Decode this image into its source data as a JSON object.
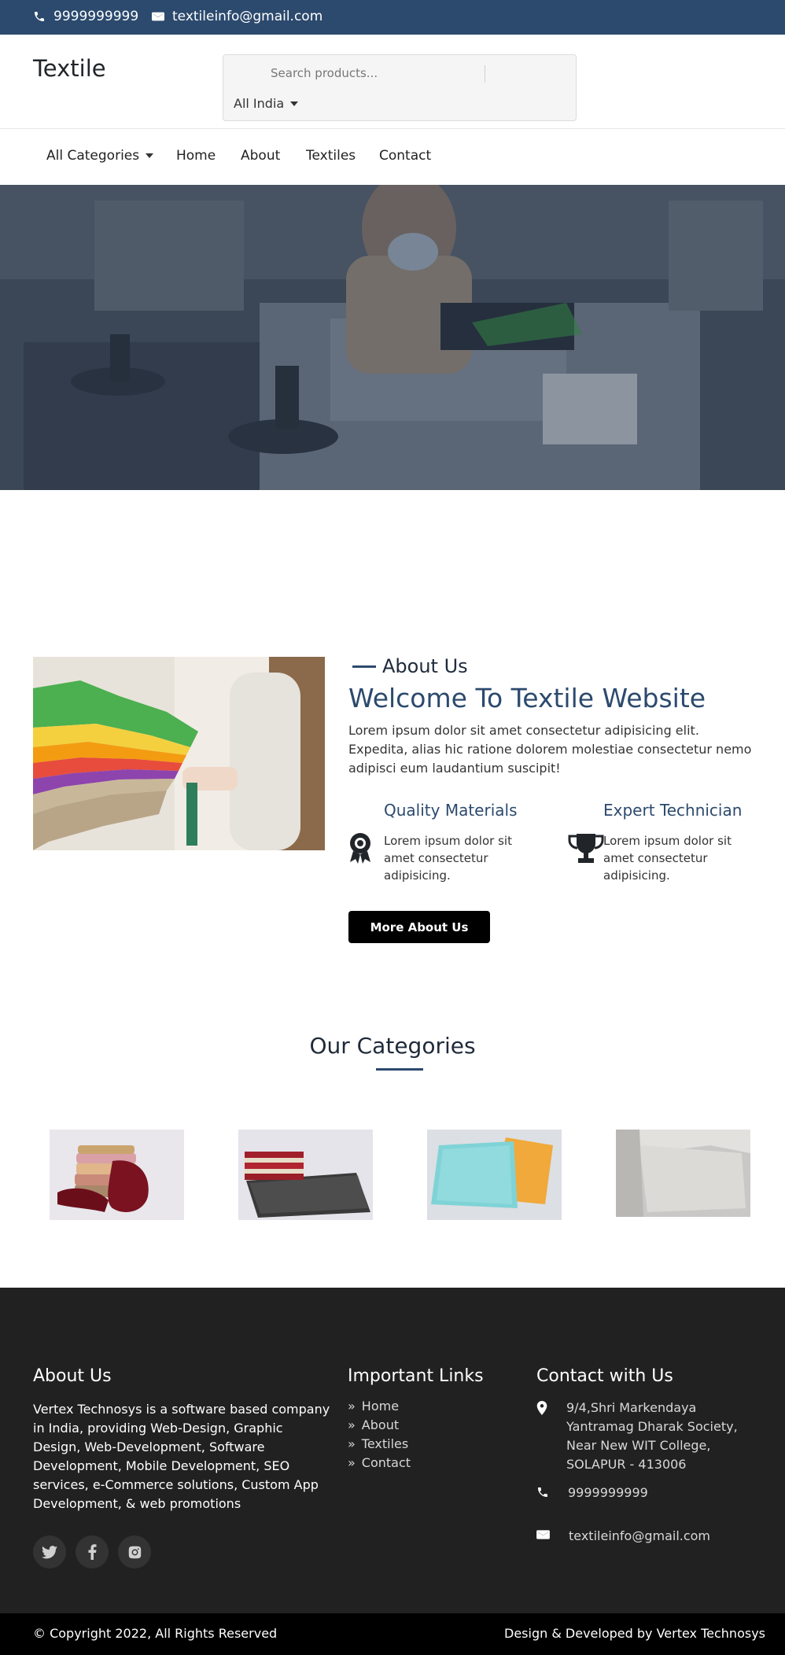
{
  "topbar": {
    "phone": "9999999999",
    "email": "textileinfo@gmail.com",
    "icons": [
      "phone-icon",
      "envelope-icon"
    ]
  },
  "header": {
    "logo": "Textile",
    "search_placeholder": "Search products...",
    "location_selected": "All India"
  },
  "nav": {
    "items": [
      "All Categories",
      "Home",
      "About",
      "Textiles",
      "Contact"
    ]
  },
  "about": {
    "eyebrow": "About Us",
    "title": "Welcome To Textile Website",
    "text": "Lorem ipsum dolor sit amet consectetur adipisicing elit. Expedita, alias hic ratione dolorem molestiae consectetur nemo adipisci eum laudantium suscipit!",
    "features": [
      {
        "title": "Quality Materials",
        "text": "Lorem ipsum dolor sit amet consectetur adipisicing.",
        "icon": "award-icon"
      },
      {
        "title": "Expert Technician",
        "text": "Lorem ipsum dolor sit amet consectetur adipisicing.",
        "icon": "trophy-icon"
      }
    ],
    "button": "More About Us"
  },
  "categories": {
    "title": "Our Categories"
  },
  "footer": {
    "about_title": "About Us",
    "about_text": "Vertex Technosys is a software based company in India, providing Web-Design, Graphic Design, Web-Development, Software Development, Mobile Development, SEO services, e-Commerce solutions, Custom App Development, & web promotions",
    "social_icons": [
      "twitter-icon",
      "facebook-icon",
      "instagram-icon"
    ],
    "links_title": "Important Links",
    "links": [
      "Home",
      "About",
      "Textiles",
      "Contact"
    ],
    "contact_title": "Contact with Us",
    "address": "9/4,Shri Markendaya Yantramag Dharak Society, Near New WIT College, SOLAPUR - 413006",
    "phone": "9999999999",
    "email": "textileinfo@gmail.com",
    "copyright": "© Copyright 2022, All Rights Reserved",
    "credit": "Design & Developed by Vertex Technosys"
  },
  "colors": {
    "brand": "#2c4a6e",
    "footer_bg": "#212121",
    "bottom_bar": "#000000"
  }
}
